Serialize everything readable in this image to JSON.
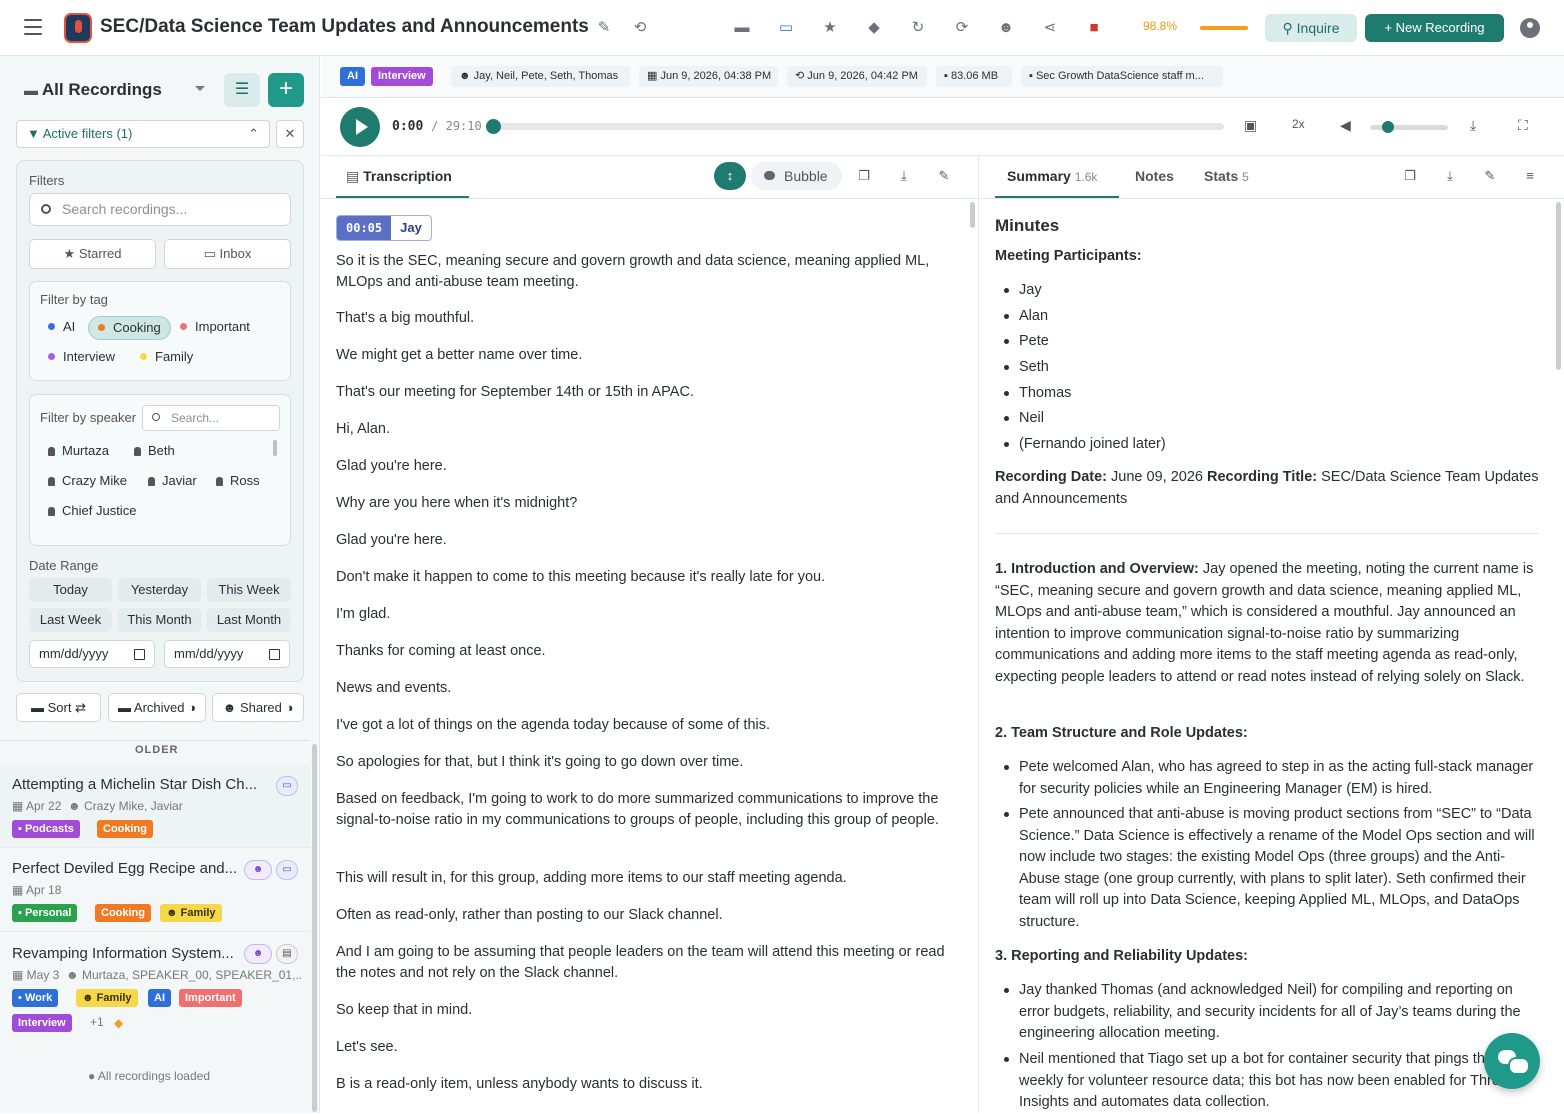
{
  "header": {
    "title": "SEC/Data Science Team Updates and Announcements",
    "battery": "98.8%",
    "inquire_label": "Inquire",
    "new_recording_label": "+ New Recording"
  },
  "sidebar": {
    "title": "All Recordings",
    "active_filters": "Active filters (1)",
    "filters_label": "Filters",
    "search_placeholder": "Search recordings...",
    "starred_label": "★ Starred",
    "inbox_label": "Inbox",
    "filter_by_tag_label": "Filter by tag",
    "tags": [
      {
        "label": "AI",
        "color": "#3b6fd8"
      },
      {
        "label": "Cooking",
        "color": "#f07a22"
      },
      {
        "label": "Important",
        "color": "#f07070"
      },
      {
        "label": "Interview",
        "color": "#a45ee0"
      },
      {
        "label": "Family",
        "color": "#f5d84a"
      }
    ],
    "filter_by_speaker_label": "Filter by speaker",
    "speaker_search_placeholder": "Search...",
    "speakers": [
      "Murtaza",
      "Beth",
      "Crazy Mike",
      "Javiar",
      "Ross",
      "Chief Justice"
    ],
    "date_range_label": "Date Range",
    "date_presets": [
      "Today",
      "Yesterday",
      "This Week",
      "Last Week",
      "This Month",
      "Last Month"
    ],
    "date_from_placeholder": "mm/dd/yyyy",
    "date_to_placeholder": "mm/dd/yyyy",
    "sort_label": "Sort ⇄",
    "archived_label": "Archived",
    "shared_label": "Shared",
    "group_label": "OLDER",
    "recordings": [
      {
        "title": "Attempting a Michelin Star Dish Ch...",
        "date": "Apr 22",
        "speakers": "Crazy Mike, Javiar",
        "tags": [
          "Podcasts",
          "Cooking"
        ]
      },
      {
        "title": "Perfect Deviled Egg Recipe and...",
        "date": "Apr 18",
        "speakers": "",
        "tags": [
          "Personal",
          "Cooking",
          "Family"
        ]
      },
      {
        "title": "Revamping Information System...",
        "date": "May 3",
        "speakers": "Murtaza, SPEAKER_00, SPEAKER_01,...",
        "tags": [
          "Work",
          "Family",
          "AI",
          "Important",
          "Interview"
        ],
        "more": "+1"
      }
    ],
    "loaded_label": "All recordings loaded"
  },
  "meta": {
    "tags": [
      "AI",
      "Interview"
    ],
    "participants": "Jay, Neil, Pete, Seth, Thomas",
    "created": "Jun 9, 2026, 04:38 PM",
    "modified": "Jun 9, 2026, 04:42 PM",
    "size": "83.06 MB",
    "file": "Sec Growth DataScience staff m..."
  },
  "player": {
    "current": "0:00",
    "duration": "/ 29:10",
    "speed": "2x",
    "progress": 0,
    "volume": 0.2
  },
  "transcript": {
    "tab_label": "Transcription",
    "bubble_label": "Bubble",
    "timestamp": "00:05",
    "speaker": "Jay",
    "lines": [
      "So it is the SEC, meaning secure and govern growth and data science, meaning applied ML, MLOps and anti-abuse team meeting.",
      "That's a big mouthful.",
      "We might get a better name over time.",
      "That's our meeting for September 14th or 15th in APAC.",
      "Hi, Alan.",
      "Glad you're here.",
      "Why are you here when it's midnight?",
      "Glad you're here.",
      "Don't make it happen to come to this meeting because it's really late for you.",
      "I'm glad.",
      "Thanks for coming at least once.",
      "News and events.",
      "I've got a lot of things on the agenda today because of some of this.",
      "So apologies for that, but I think it's going to go down over time.",
      "Based on feedback, I'm going to work to do more summarized communications to improve the signal-to-noise ratio in my communications to groups of people, including this group of people.",
      "This will result in, for this group, adding more items to our staff meeting agenda.",
      "Often as read-only, rather than posting to our Slack channel.",
      "And I am going to be assuming that people leaders on the team will attend this meeting or read the notes and not rely on the Slack channel.",
      "So keep that in mind.",
      "Let's see.",
      "B is a read-only item, unless anybody wants to discuss it."
    ]
  },
  "summary": {
    "tabs": [
      {
        "label": "Summary",
        "count": "1.6k"
      },
      {
        "label": "Notes",
        "count": ""
      },
      {
        "label": "Stats",
        "count": "5"
      }
    ],
    "heading": "Minutes",
    "participants_label": "Meeting Participants:",
    "participants": [
      "Jay",
      "Alan",
      "Pete",
      "Seth",
      "Thomas",
      "Neil",
      "(Fernando joined later)"
    ],
    "recording_date_label": "Recording Date:",
    "recording_date": "June 09, 2026",
    "recording_title_label": "Recording Title:",
    "recording_title": "SEC/Data Science Team Updates and Announcements",
    "s1_title": "1. Introduction and Overview:",
    "s1_text": "Jay opened the meeting, noting the current name is “SEC, meaning secure and govern growth and data science, meaning applied ML, MLOps and anti-abuse team,” which is considered a mouthful. Jay announced an intention to improve communication signal-to-noise ratio by summarizing communications and adding more items to the staff meeting agenda as read-only, expecting people leaders to attend or read notes instead of relying solely on Slack.",
    "s2_title": "2. Team Structure and Role Updates:",
    "s2_bullets": [
      "Pete welcomed Alan, who has agreed to step in as the acting full-stack manager for security policies while an Engineering Manager (EM) is hired.",
      "Pete announced that anti-abuse is moving product sections from “SEC” to “Data Science.” Data Science is effectively a rename of the Model Ops section and will now include two stages: the existing Model Ops (three groups) and the Anti-Abuse stage (one group currently, with plans to split later). Seth confirmed their team will roll up into Data Science, keeping Applied ML, MLOps, and DataOps structure."
    ],
    "s3_title": "3. Reporting and Reliability Updates:",
    "s3_bullets": [
      "Jay thanked Thomas (and acknowledged Neil) for compiling and reporting on error budgets, reliability, and security incidents for all of Jay’s teams during the engineering allocation meeting.",
      "Neil mentioned that Tiago set up a bot for container security that pings the team weekly for volunteer resource data; this bot has now been enabled for Threat Insights and automates data collection."
    ]
  }
}
